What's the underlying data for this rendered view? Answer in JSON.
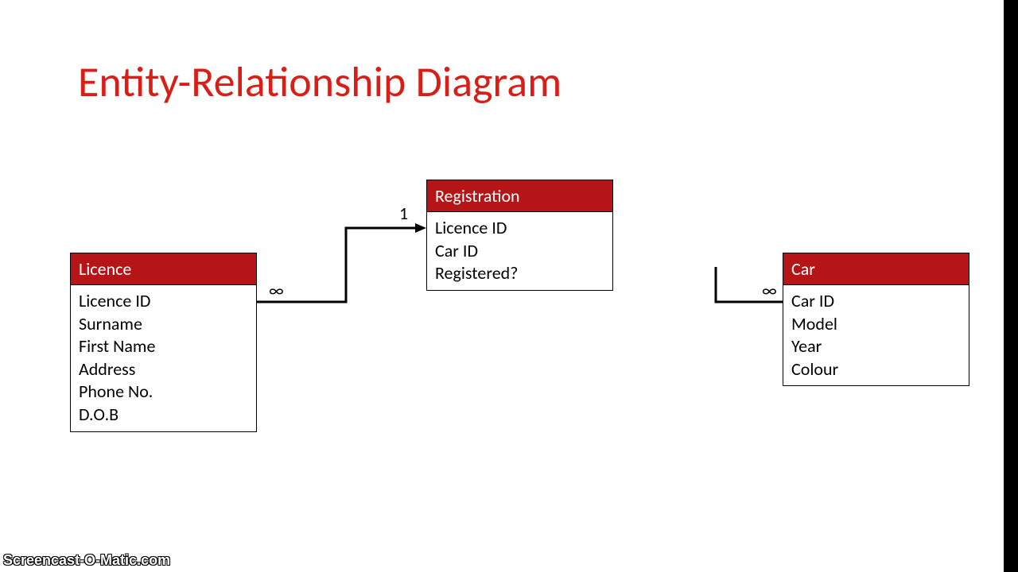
{
  "title": "Entity-Relationship Diagram",
  "entities": {
    "licence": {
      "name": "Licence",
      "attrs": [
        "Licence ID",
        "Surname",
        "First Name",
        "Address",
        "Phone No.",
        "D.O.B"
      ]
    },
    "registration": {
      "name": "Registration",
      "attrs": [
        "Licence ID",
        "Car ID",
        "Registered?"
      ]
    },
    "car": {
      "name": "Car",
      "attrs": [
        "Car ID",
        "Model",
        "Year",
        "Colour"
      ]
    }
  },
  "labels": {
    "left_many": "∞",
    "left_one": "1",
    "right_many": "∞"
  },
  "watermark": "Screencast-O-Matic.com"
}
